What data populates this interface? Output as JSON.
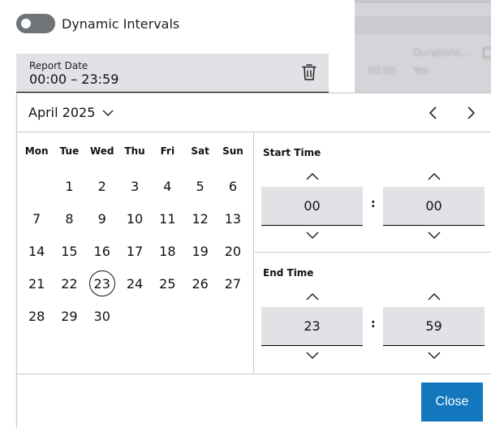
{
  "toggle": {
    "label": "Dynamic Intervals",
    "on": false
  },
  "report_date": {
    "label": "Report Date",
    "value": "00:00 – 23:59",
    "delete_icon": "trash-icon"
  },
  "background": {
    "col_header": "Durations...",
    "cell_time": "00:00",
    "cell_value": "Yes"
  },
  "calendar": {
    "month_label": "April 2025",
    "weekdays": [
      "Mon",
      "Tue",
      "Wed",
      "Thu",
      "Fri",
      "Sat",
      "Sun"
    ],
    "leading_blanks": 1,
    "days": [
      "1",
      "2",
      "3",
      "4",
      "5",
      "6",
      "7",
      "8",
      "9",
      "10",
      "11",
      "12",
      "13",
      "14",
      "15",
      "16",
      "17",
      "18",
      "19",
      "20",
      "21",
      "22",
      "23",
      "24",
      "25",
      "26",
      "27",
      "28",
      "29",
      "30"
    ],
    "today": "23"
  },
  "time": {
    "start_title": "Start Time",
    "start_hour": "00",
    "start_minute": "00",
    "end_title": "End Time",
    "end_hour": "23",
    "end_minute": "59",
    "separator": ":"
  },
  "footer": {
    "close_label": "Close"
  },
  "colors": {
    "accent": "#1277bd",
    "field_bg": "#e0e2e5",
    "toggle_off": "#6f7479",
    "divider": "#c7c9cc"
  }
}
